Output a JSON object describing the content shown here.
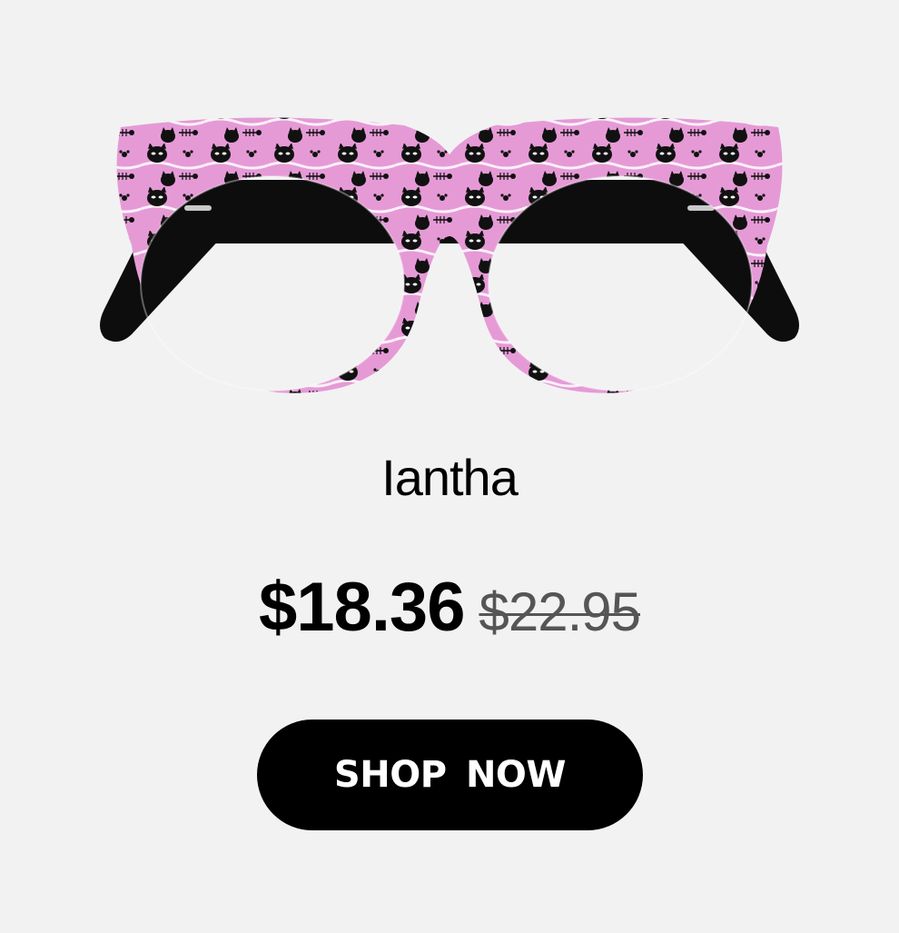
{
  "product": {
    "name": "Iantha",
    "price_current": "$18.36",
    "price_original": "$22.95",
    "cta_label": "SHOP  NOW",
    "image_icon": "cat-eye-glasses-icon",
    "frame_color": "#e59ad6",
    "pattern_color": "#000000"
  }
}
